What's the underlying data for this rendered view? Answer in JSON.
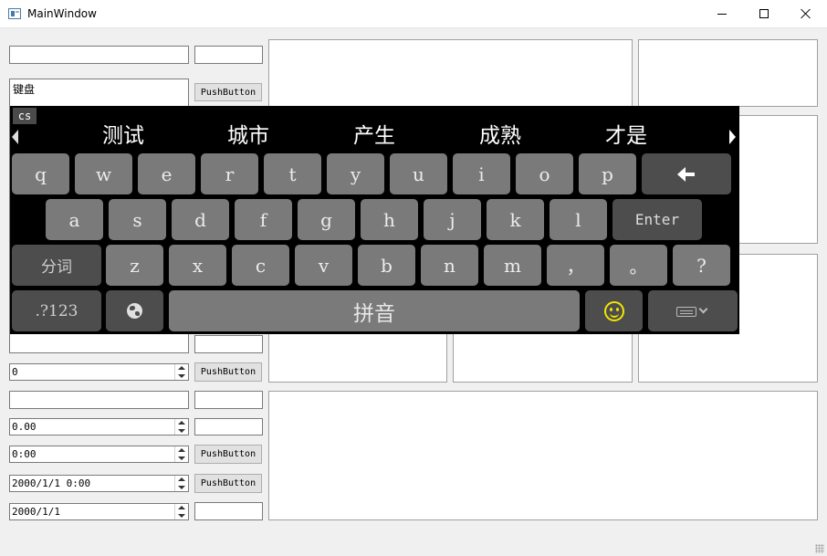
{
  "window": {
    "title": "MainWindow"
  },
  "form": {
    "keyboard_input_value": "键盘",
    "int_spin_value": "0",
    "double_spin_value": "0.00",
    "time_value": "0:00",
    "datetime_value": "2000/1/1 0:00",
    "date_value": "2000/1/1",
    "pushbutton_label": "PushButton"
  },
  "keyboard": {
    "language_badge": "cs",
    "candidates": [
      "测试",
      "城市",
      "产生",
      "成熟",
      "才是"
    ],
    "row1": [
      "q",
      "w",
      "e",
      "r",
      "t",
      "y",
      "u",
      "i",
      "o",
      "p"
    ],
    "row2": [
      "a",
      "s",
      "d",
      "f",
      "g",
      "h",
      "j",
      "k",
      "l"
    ],
    "enter_label": "Enter",
    "segment_label": "分词",
    "row3": [
      "z",
      "x",
      "c",
      "v",
      "b",
      "n",
      "m",
      "，",
      "。",
      "?"
    ],
    "symbols_label": ".?123",
    "space_label": "拼音",
    "icons": {
      "backspace": "backspace-icon",
      "globe": "globe-icon",
      "emoji": "smiley-icon",
      "hide": "hide-keyboard-icon",
      "prev": "chevron-left-icon",
      "next": "chevron-right-icon"
    },
    "colors": {
      "background": "#000000",
      "key": "#7a7a7a",
      "function_key": "#4d4d4d",
      "emoji": "#f3e600"
    }
  }
}
